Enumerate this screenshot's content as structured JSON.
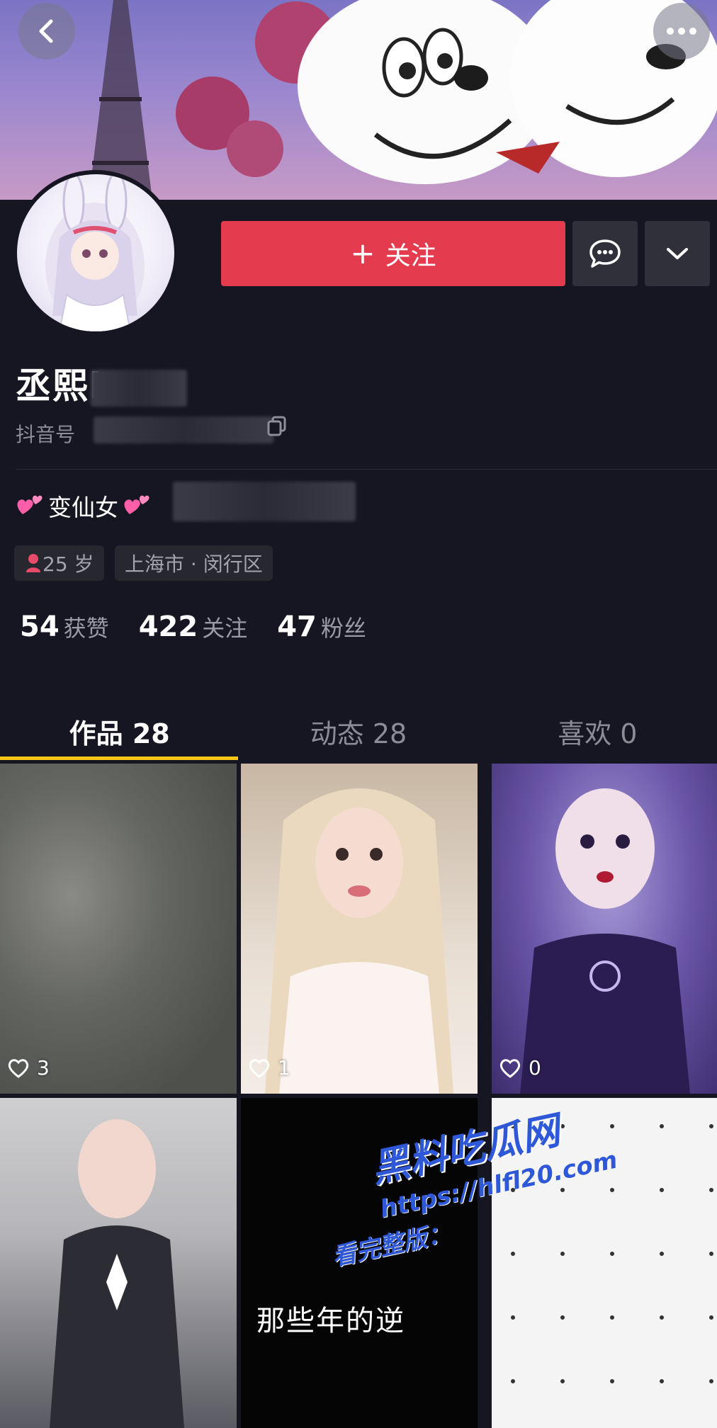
{
  "header": {
    "back_icon": "chevron-left-icon",
    "more_icon": "more-horizontal-icon"
  },
  "actions": {
    "follow_label": "关注",
    "follow_plus": "+",
    "message_icon": "chat-bubble-icon",
    "dropdown_icon": "chevron-down-icon",
    "accent_color": "#e43b4e"
  },
  "profile": {
    "username": "丞熙b",
    "douyin_id_label": "抖音号",
    "bio": "变仙女",
    "age_tag": "25 岁",
    "location_tag": "上海市 · 闵行区"
  },
  "stats": [
    {
      "value": "54",
      "label": "获赞"
    },
    {
      "value": "422",
      "label": "关注"
    },
    {
      "value": "47",
      "label": "粉丝"
    }
  ],
  "tabs": [
    {
      "label": "作品 28",
      "active": true
    },
    {
      "label": "动态 28",
      "active": false
    },
    {
      "label": "喜欢 0",
      "active": false
    }
  ],
  "grid": [
    {
      "likes": "3"
    },
    {
      "likes": "1"
    },
    {
      "likes": "0"
    },
    {
      "likes": ""
    },
    {
      "likes": "",
      "caption": "那些年的逆"
    },
    {
      "likes": ""
    }
  ],
  "watermark": {
    "title": "黑料吃瓜网",
    "url": "https://hlfl20.com",
    "extra": "看完整版："
  }
}
